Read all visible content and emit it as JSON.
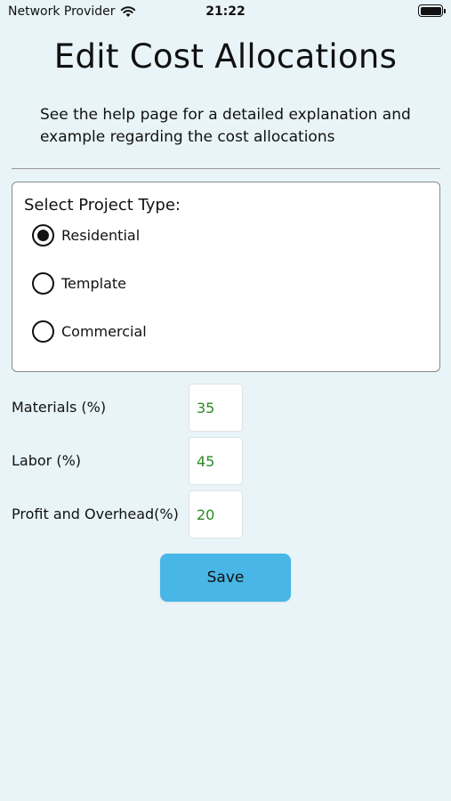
{
  "status_bar": {
    "carrier": "Network Provider",
    "time": "21:22"
  },
  "page": {
    "title": "Edit Cost Allocations",
    "help_text": "See the help page for a detailed explanation and example regarding the cost allocations"
  },
  "project_type": {
    "label": "Select Project Type:",
    "selected": "Residential",
    "options": [
      {
        "label": "Residential",
        "checked": true
      },
      {
        "label": "Template",
        "checked": false
      },
      {
        "label": "Commercial",
        "checked": false
      }
    ]
  },
  "fields": [
    {
      "label": "Materials (%)",
      "value": "35"
    },
    {
      "label": "Labor (%)",
      "value": "45"
    },
    {
      "label": "Profit and Overhead(%)",
      "value": "20"
    }
  ],
  "actions": {
    "save_label": "Save"
  },
  "colors": {
    "background": "#e8f4f7",
    "accent": "#48b6e6",
    "value_text": "#2a8a22"
  },
  "icons": {
    "signal": "wifi-icon",
    "battery": "battery-icon"
  }
}
